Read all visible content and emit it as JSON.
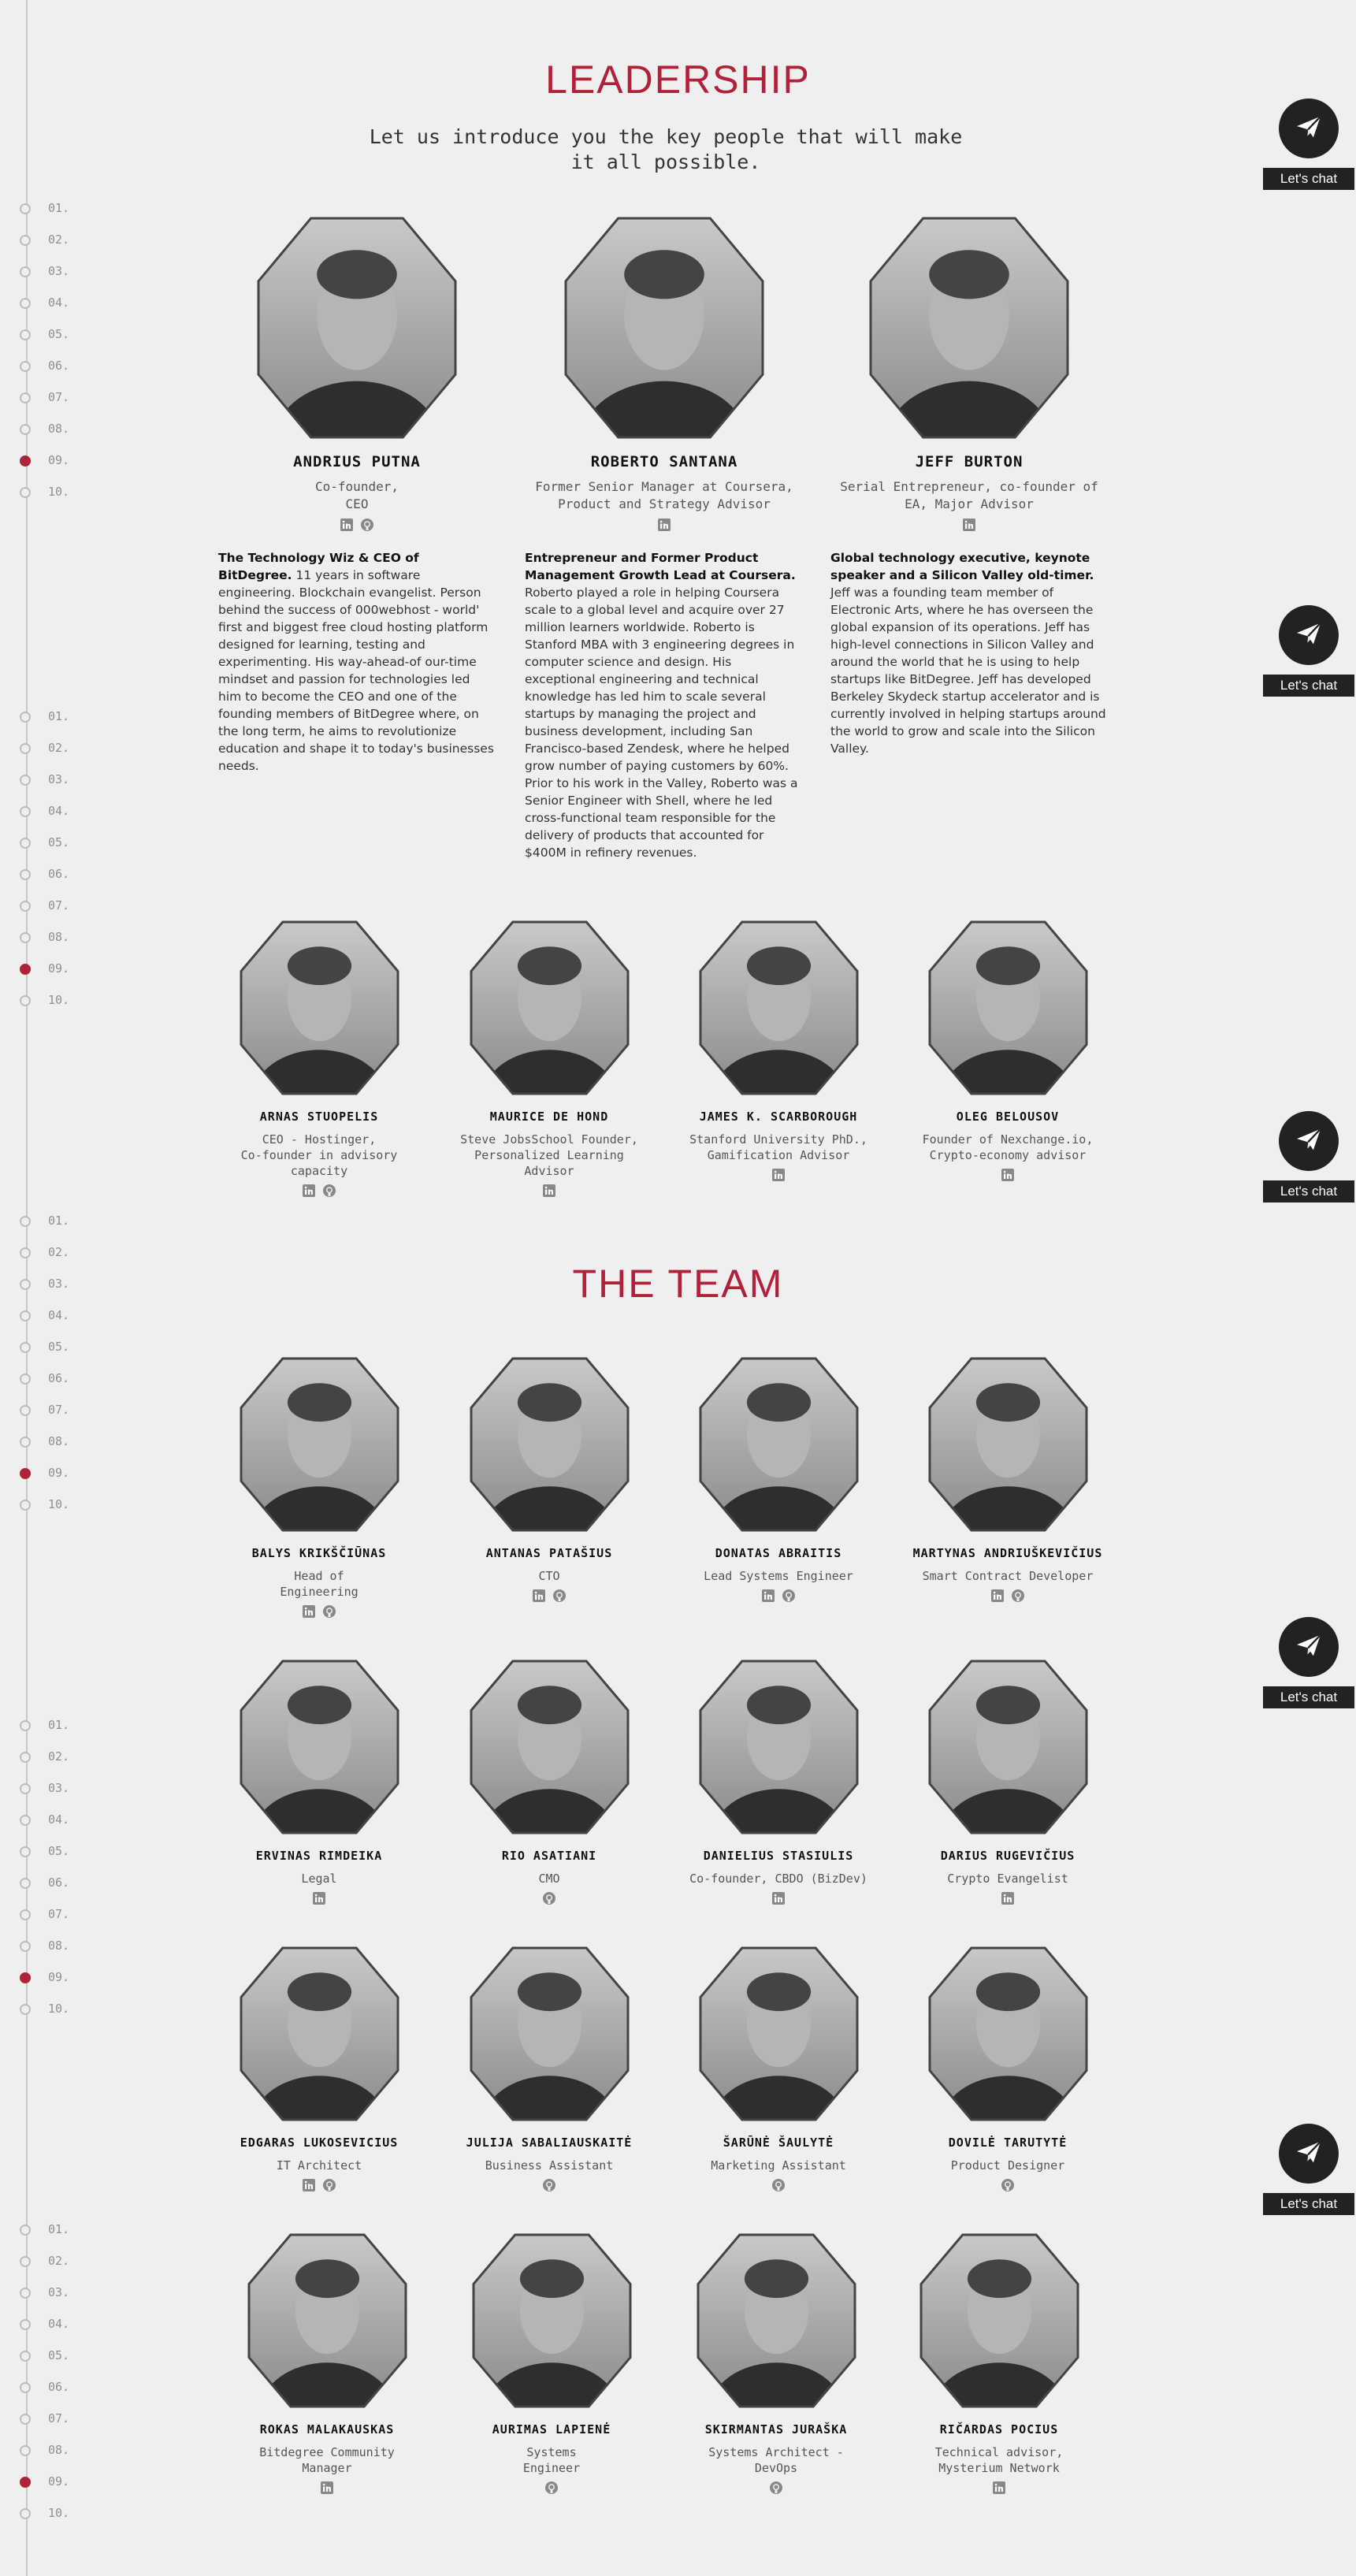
{
  "leadership": {
    "title": "LEADERSHIP",
    "intro": "Let us introduce you the key people that will make it all possible."
  },
  "team": {
    "title": "THE TEAM"
  },
  "chat_label": "Let's chat",
  "timeline_numbers": [
    "01.",
    "02.",
    "03.",
    "04.",
    "05.",
    "06.",
    "07.",
    "08.",
    "09.",
    "10."
  ],
  "leaders": [
    {
      "name": "ANDRIUS PUTNA",
      "role": "Co-founder,\nCEO",
      "bio_bold": "The Technology Wiz & CEO of BitDegree.",
      "bio": " 11 years in software engineering. Blockchain evangelist. Person behind the success of 000webhost - world' first and biggest free cloud hosting platform designed for learning, testing and experimenting. His way-ahead-of our-time mindset and passion for technologies led him to become the CEO and one of the founding members of BitDegree where, on the long term, he aims to revolutionize education and shape it to today's businesses needs.",
      "icons": [
        "linkedin",
        "github"
      ]
    },
    {
      "name": "ROBERTO SANTANA",
      "role": "Former Senior Manager at Coursera,\nProduct and Strategy Advisor",
      "bio_bold": "Entrepreneur and Former Product Management Growth Lead at Coursera.",
      "bio": " Roberto played a role in helping Coursera scale to a global level and acquire over 27 million learners worldwide. Roberto is Stanford MBA with 3 engineering degrees in computer science and design. His exceptional engineering and technical knowledge has led him to scale several startups by managing the project and business development, including San Francisco-based Zendesk, where he helped grow number of paying customers by 60%. Prior to his work in the Valley, Roberto was a Senior Engineer with Shell, where he led cross-functional team responsible for the delivery of products that accounted for $400M in refinery revenues.",
      "icons": [
        "linkedin"
      ]
    },
    {
      "name": "JEFF BURTON",
      "role": "Serial Entrepreneur, co-founder of\nEA, Major Advisor",
      "bio_bold": "Global technology executive, keynote speaker and a Silicon Valley old-timer.",
      "bio": " Jeff was a founding team member of Electronic Arts, where he has overseen the global expansion of its operations. Jeff has high-level connections in Silicon Valley and around the world that he is using to help startups like BitDegree. Jeff has developed Berkeley Skydeck startup accelerator and is currently involved in helping startups around the world to grow and scale into the Silicon Valley.",
      "icons": [
        "linkedin"
      ]
    }
  ],
  "advisors": [
    {
      "name": "ARNAS STUOPELIS",
      "role": "CEO - Hostinger,\nCo-founder in advisory\ncapacity",
      "icons": [
        "linkedin",
        "github"
      ]
    },
    {
      "name": "MAURICE DE HOND",
      "role": "Steve JobsSchool Founder,\nPersonalized Learning\nAdvisor",
      "icons": [
        "linkedin"
      ]
    },
    {
      "name": "JAMES K. SCARBOROUGH",
      "role": "Stanford University PhD.,\nGamification Advisor",
      "icons": [
        "linkedin"
      ]
    },
    {
      "name": "OLEG BELOUSOV",
      "role": "Founder of Nexchange.io,\nCrypto-economy advisor",
      "icons": [
        "linkedin"
      ]
    }
  ],
  "team_rows": [
    [
      {
        "name": "BALYS KRIKŠČIŪNAS",
        "role": "Head of\nEngineering",
        "icons": [
          "linkedin",
          "github"
        ]
      },
      {
        "name": "ANTANAS PATAŠIUS",
        "role": "CTO",
        "icons": [
          "linkedin",
          "github"
        ]
      },
      {
        "name": "DONATAS ABRAITIS",
        "role": "Lead Systems Engineer",
        "icons": [
          "linkedin",
          "github"
        ]
      },
      {
        "name": "MARTYNAS ANDRIUŠKEVIČIUS",
        "role": "Smart Contract Developer",
        "icons": [
          "linkedin",
          "github"
        ]
      }
    ],
    [
      {
        "name": "ERVINAS RIMDEIKA",
        "role": "Legal",
        "icons": [
          "linkedin"
        ]
      },
      {
        "name": "RIO ASATIANI",
        "role": "CMO",
        "icons": [
          "github"
        ]
      },
      {
        "name": "DANIELIUS STASIULIS",
        "role": "Co-founder, CBDO (BizDev)",
        "icons": [
          "linkedin"
        ]
      },
      {
        "name": "DARIUS RUGEVIČIUS",
        "role": "Crypto Evangelist",
        "icons": [
          "linkedin"
        ]
      }
    ],
    [
      {
        "name": "EDGARAS LUKOSEVICIUS",
        "role": "IT Architect",
        "icons": [
          "linkedin",
          "github"
        ]
      },
      {
        "name": "JULIJA SABALIAUSKAITĖ",
        "role": "Business Assistant",
        "icons": [
          "github"
        ]
      },
      {
        "name": "ŠARŪNĖ ŠAULYTĖ",
        "role": "Marketing Assistant",
        "icons": [
          "github"
        ]
      },
      {
        "name": "DOVILĖ TARUTYTĖ",
        "role": "Product Designer",
        "icons": [
          "github"
        ]
      }
    ],
    [
      {
        "name": "ROKAS MALAKAUSKAS",
        "role": "Bitdegree Community\nManager",
        "icons": [
          "linkedin"
        ]
      },
      {
        "name": "AURIMAS LAPIENĖ",
        "role": "Systems\nEngineer",
        "icons": [
          "github"
        ]
      },
      {
        "name": "SKIRMANTAS JURAŠKA",
        "role": "Systems Architect -\nDevOps",
        "icons": [
          "github"
        ]
      },
      {
        "name": "RIČARDAS POCIUS",
        "role": "Technical advisor,\nMysterium Network",
        "icons": [
          "linkedin"
        ]
      }
    ]
  ]
}
